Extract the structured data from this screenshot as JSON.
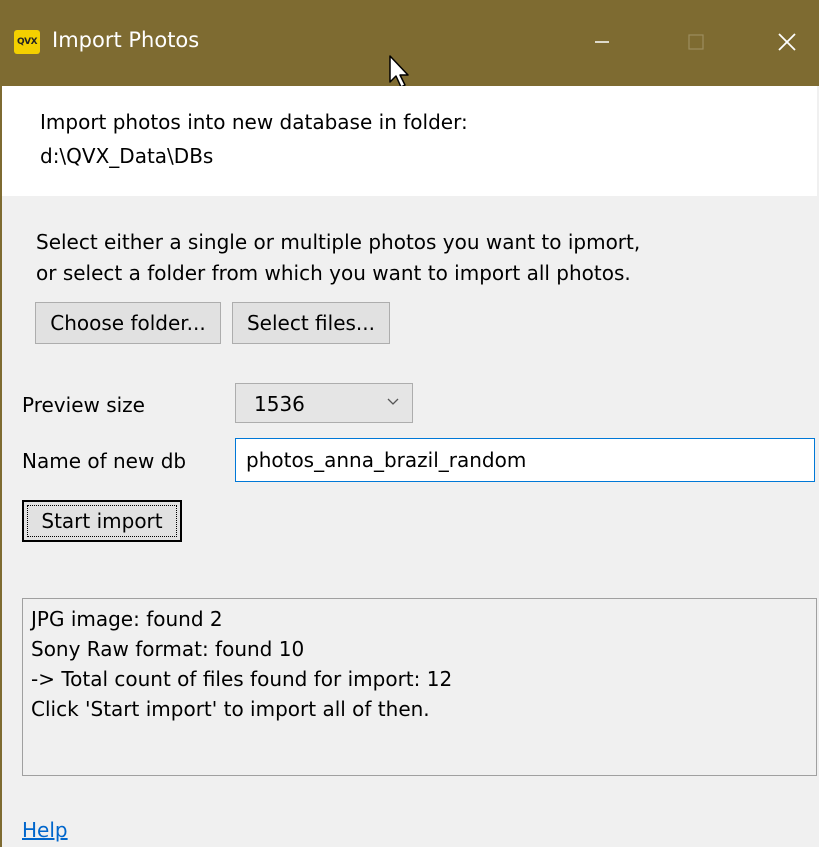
{
  "window": {
    "title": "Import Photos",
    "icon_text": "QVX",
    "controls": [
      "minimize-icon",
      "maximize-icon",
      "close-icon"
    ]
  },
  "info": {
    "line1": "Import photos into new database in folder:",
    "line2": "d:\\QVX_Data\\DBs"
  },
  "instructions": {
    "line1": "Select either a single or multiple photos you want to ipmort,",
    "line2": "or select a folder from which you want to import all photos."
  },
  "buttons": {
    "choose_folder": "Choose folder...",
    "select_files": "Select files...",
    "start_import": "Start import"
  },
  "preview": {
    "label": "Preview size",
    "value": "1536"
  },
  "db_name": {
    "label": "Name of new db",
    "value": "photos_anna_brazil_random"
  },
  "log": {
    "lines": [
      "JPG image: found 2",
      "Sony Raw format: found 10",
      "-> Total count of files found for import: 12",
      "Click 'Start import' to import all of then."
    ]
  },
  "help": {
    "label": "Help"
  },
  "colors": {
    "titlebar": "#7e6b31",
    "accent": "#0078d7",
    "link": "#0066cc"
  }
}
